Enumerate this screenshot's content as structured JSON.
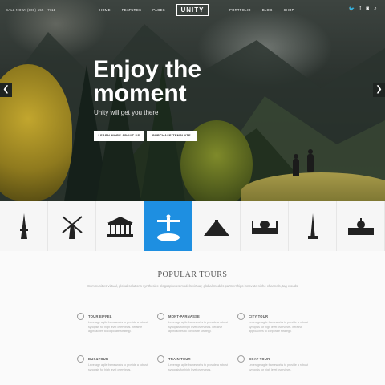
{
  "header": {
    "call": "CALL NOW: (808) 555 - 7111",
    "logo": "UNITY",
    "nav_left": [
      "HOME",
      "FEATURES",
      "PAGES"
    ],
    "nav_right": [
      "PORTFOLIO",
      "BLOG",
      "SHOP"
    ],
    "social": [
      "twitter-icon",
      "facebook-icon",
      "instagram-icon",
      "search-icon"
    ]
  },
  "hero": {
    "title_line1": "Enjoy the",
    "title_line2": "moment",
    "subtitle": "Unity will get you there",
    "btn_learn": "LEARN MORE ABOUT US",
    "btn_purchase": "PURCHASE TEMPLATE",
    "arrow_left": "❮",
    "arrow_right": "❯"
  },
  "landmarks": [
    {
      "name": "eiffel-tower-icon",
      "active": false
    },
    {
      "name": "windmill-icon",
      "active": false
    },
    {
      "name": "parthenon-icon",
      "active": false
    },
    {
      "name": "christ-redeemer-icon",
      "active": true
    },
    {
      "name": "pyramid-icon",
      "active": false
    },
    {
      "name": "taj-mahal-icon",
      "active": false
    },
    {
      "name": "burj-khalifa-icon",
      "active": false
    },
    {
      "name": "capitol-icon",
      "active": false
    }
  ],
  "tours": {
    "title": "POPULAR TOURS",
    "description": "Communities virtual, global solutions synthesize blogospheres models virtual; global models partnerships innovate niche channels, tag clouds",
    "items": [
      {
        "name": "TOUR EIFFEL",
        "icon": "clock-icon",
        "text": "Leverage agile frameworks to provide a robust synopsis for high level overviews. Iterative approaches to corporate strategy."
      },
      {
        "name": "MONT-PARNASSE",
        "icon": "megaphone-icon",
        "text": "Leverage agile frameworks to provide a robust synopsis for high level overviews. Iterative approaches to corporate strategy."
      },
      {
        "name": "CITY TOUR",
        "icon": "wifi-icon",
        "text": "Leverage agile frameworks to provide a robust synopsis for high level overviews. Iterative approaches to corporate strategy."
      },
      {
        "name": "BUS&TOUR",
        "icon": "sun-icon",
        "text": "Leverage agile frameworks to provide a robust synopsis for high level overviews."
      },
      {
        "name": "TRAIN TOUR",
        "icon": "globe-icon",
        "text": "Leverage agile frameworks to provide a robust synopsis for high level overviews."
      },
      {
        "name": "BOAT TOUR",
        "icon": "tag-icon",
        "text": "Leverage agile frameworks to provide a robust synopsis for high level overviews."
      }
    ]
  },
  "colors": {
    "accent": "#1e8fe1",
    "hero_dark": "#2d3430"
  }
}
